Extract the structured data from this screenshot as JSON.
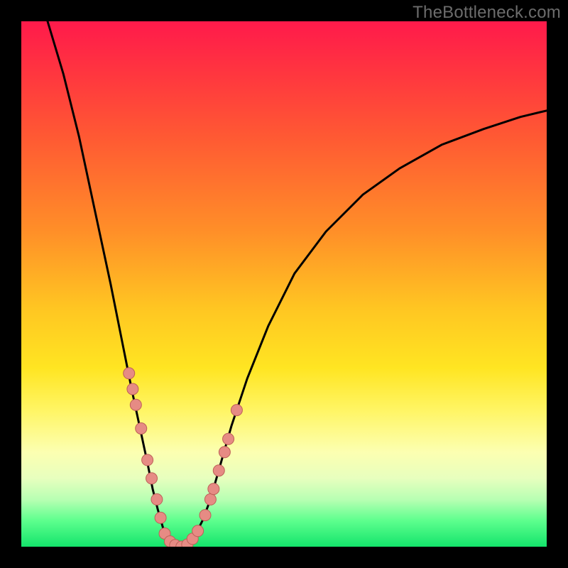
{
  "watermark": "TheBottleneck.com",
  "colors": {
    "background": "#000000",
    "curve": "#000000",
    "marker_fill": "#e68b84",
    "marker_stroke": "#bd6057",
    "gradient": [
      "#ff1a4b",
      "#ff363f",
      "#ff5933",
      "#ff8f28",
      "#ffc722",
      "#ffe522",
      "#fff564",
      "#fcffb1",
      "#e7ffbe",
      "#b8ffb3",
      "#5eff8e",
      "#14e46b"
    ]
  },
  "chart_data": {
    "type": "line",
    "title": "",
    "xlabel": "",
    "ylabel": "",
    "xlim": [
      0,
      100
    ],
    "ylim": [
      0,
      100
    ],
    "grid": false,
    "curve": [
      {
        "x": 5.0,
        "y": 100.0
      },
      {
        "x": 8.0,
        "y": 90.0
      },
      {
        "x": 11.0,
        "y": 78.0
      },
      {
        "x": 14.0,
        "y": 64.0
      },
      {
        "x": 17.0,
        "y": 50.0
      },
      {
        "x": 19.0,
        "y": 40.0
      },
      {
        "x": 21.0,
        "y": 30.0
      },
      {
        "x": 22.5,
        "y": 23.0
      },
      {
        "x": 24.0,
        "y": 16.0
      },
      {
        "x": 25.0,
        "y": 11.0
      },
      {
        "x": 26.0,
        "y": 7.0
      },
      {
        "x": 27.0,
        "y": 3.5
      },
      {
        "x": 28.0,
        "y": 1.5
      },
      {
        "x": 29.0,
        "y": 0.5
      },
      {
        "x": 30.5,
        "y": 0.0
      },
      {
        "x": 32.0,
        "y": 0.7
      },
      {
        "x": 33.0,
        "y": 2.0
      },
      {
        "x": 34.5,
        "y": 5.0
      },
      {
        "x": 36.0,
        "y": 9.0
      },
      {
        "x": 38.0,
        "y": 16.0
      },
      {
        "x": 40.0,
        "y": 23.0
      },
      {
        "x": 43.0,
        "y": 32.0
      },
      {
        "x": 47.0,
        "y": 42.0
      },
      {
        "x": 52.0,
        "y": 52.0
      },
      {
        "x": 58.0,
        "y": 60.0
      },
      {
        "x": 65.0,
        "y": 67.0
      },
      {
        "x": 72.0,
        "y": 72.0
      },
      {
        "x": 80.0,
        "y": 76.5
      },
      {
        "x": 88.0,
        "y": 79.5
      },
      {
        "x": 95.0,
        "y": 81.8
      },
      {
        "x": 100.0,
        "y": 83.0
      }
    ],
    "markers": [
      {
        "x": 20.5,
        "y": 33.0
      },
      {
        "x": 21.2,
        "y": 30.0
      },
      {
        "x": 21.8,
        "y": 27.0
      },
      {
        "x": 22.8,
        "y": 22.5
      },
      {
        "x": 24.0,
        "y": 16.5
      },
      {
        "x": 24.8,
        "y": 13.0
      },
      {
        "x": 25.8,
        "y": 9.0
      },
      {
        "x": 26.5,
        "y": 5.5
      },
      {
        "x": 27.3,
        "y": 2.5
      },
      {
        "x": 28.3,
        "y": 1.0
      },
      {
        "x": 29.3,
        "y": 0.3
      },
      {
        "x": 30.5,
        "y": 0.0
      },
      {
        "x": 31.6,
        "y": 0.4
      },
      {
        "x": 32.6,
        "y": 1.5
      },
      {
        "x": 33.6,
        "y": 3.0
      },
      {
        "x": 35.0,
        "y": 6.0
      },
      {
        "x": 36.0,
        "y": 9.0
      },
      {
        "x": 36.6,
        "y": 11.0
      },
      {
        "x": 37.6,
        "y": 14.5
      },
      {
        "x": 38.7,
        "y": 18.0
      },
      {
        "x": 39.4,
        "y": 20.5
      },
      {
        "x": 41.0,
        "y": 26.0
      }
    ],
    "marker_radius_px": 8
  }
}
